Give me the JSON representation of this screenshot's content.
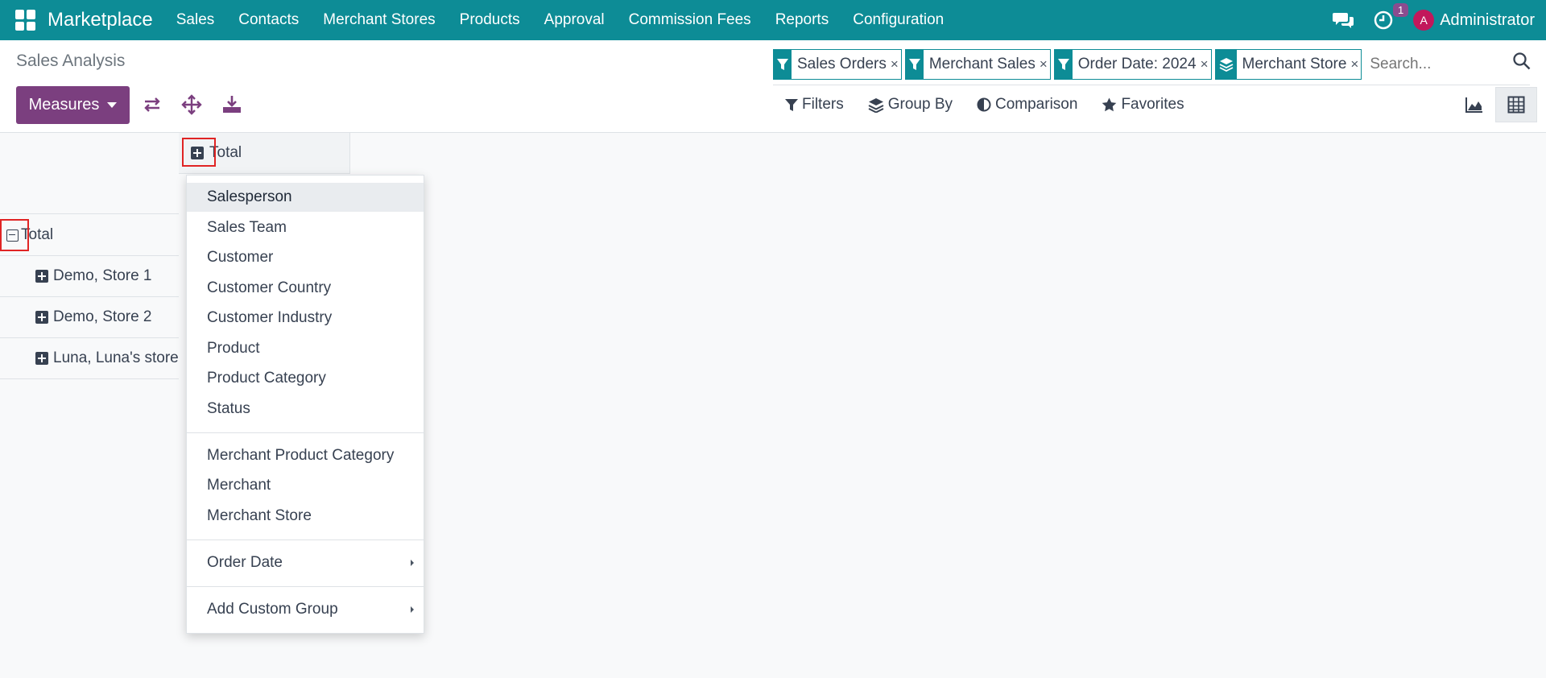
{
  "navbar": {
    "app_name": "Marketplace",
    "menu": [
      "Sales",
      "Contacts",
      "Merchant Stores",
      "Products",
      "Approval",
      "Commission Fees",
      "Reports",
      "Configuration"
    ],
    "activity_count": "1",
    "user_initial": "A",
    "user_name": "Administrator"
  },
  "control_panel": {
    "breadcrumb": "Sales Analysis",
    "measures_label": "Measures",
    "facets": [
      {
        "icon": "filter-icon",
        "label": "Sales Orders"
      },
      {
        "icon": "filter-icon",
        "label": "Merchant Sales"
      },
      {
        "icon": "filter-icon",
        "label": "Order Date: 2024"
      },
      {
        "icon": "layers-icon",
        "label": "Merchant Store"
      }
    ],
    "search_placeholder": "Search...",
    "filter_bar": {
      "filters": "Filters",
      "group_by": "Group By",
      "comparison": "Comparison",
      "favorites": "Favorites"
    }
  },
  "pivot": {
    "column_header": "Total",
    "row_total": "Total",
    "rows": [
      "Demo, Store 1",
      "Demo, Store 2",
      "Luna, Luna's store"
    ]
  },
  "group_by_dropdown": {
    "section1": [
      "Salesperson",
      "Sales Team",
      "Customer",
      "Customer Country",
      "Customer Industry",
      "Product",
      "Product Category",
      "Status"
    ],
    "section2": [
      "Merchant Product Category",
      "Merchant",
      "Merchant Store"
    ],
    "section3": [
      "Order Date"
    ],
    "section4": [
      "Add Custom Group"
    ],
    "highlighted": "Salesperson"
  },
  "colors": {
    "navbar": "#0d8c96",
    "primary_button": "#7b3f7f",
    "highlight_box": "#e02424"
  }
}
